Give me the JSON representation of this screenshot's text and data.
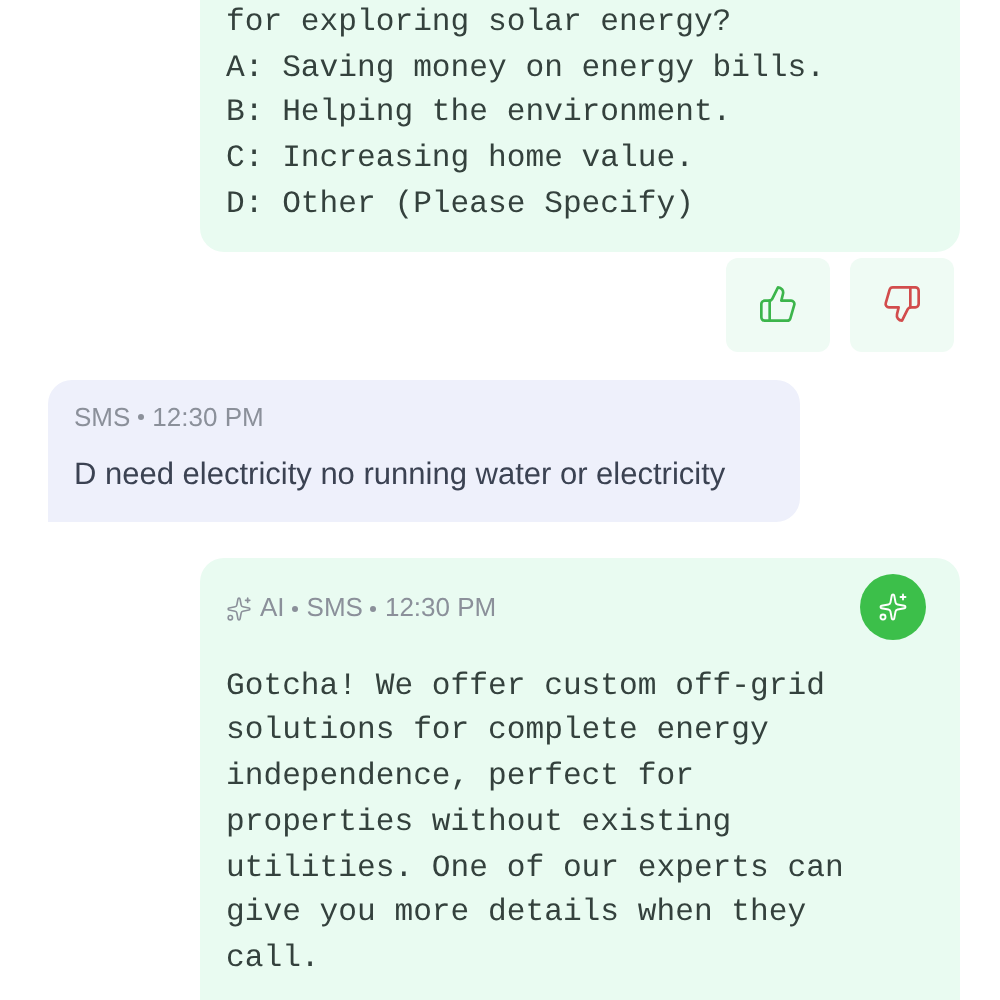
{
  "messages": [
    {
      "kind": "ai_reply",
      "lines": [
        "for exploring solar energy?",
        "A: Saving money on energy bills.",
        "B: Helping the environment.",
        "C: Increasing home value.",
        "D: Other (Please Specify)"
      ]
    },
    {
      "kind": "feedback",
      "thumbs_up": {
        "selected": false
      },
      "thumbs_down": {
        "selected": false
      }
    },
    {
      "kind": "incoming",
      "channel": "SMS",
      "time": "12:30 PM",
      "text": "D need electricity no running water or electricity"
    },
    {
      "kind": "ai_message",
      "source": "AI",
      "channel": "SMS",
      "time": "12:30 PM",
      "text": "Gotcha! We offer custom off-grid solutions for complete energy independence, perfect for properties without existing utilities. One of our experts can give you more details when they call."
    }
  ]
}
